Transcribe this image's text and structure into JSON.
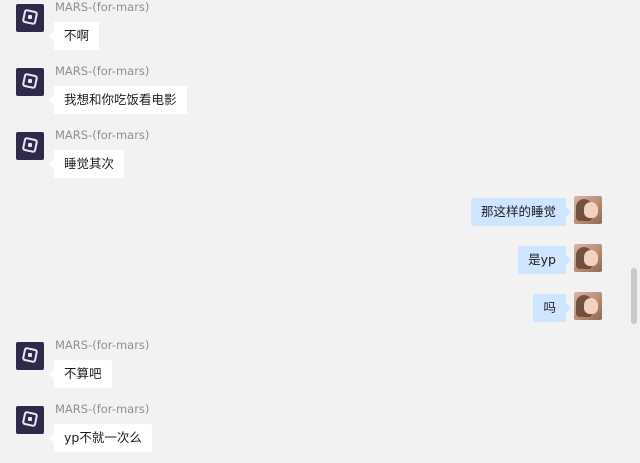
{
  "chat": {
    "messages": [
      {
        "side": "left",
        "sender": "MARS-(for-mars)",
        "text": "不啊"
      },
      {
        "side": "left",
        "sender": "MARS-(for-mars)",
        "text": "我想和你吃饭看电影"
      },
      {
        "side": "left",
        "sender": "MARS-(for-mars)",
        "text": "睡觉其次"
      },
      {
        "side": "right",
        "text": "那这样的睡觉"
      },
      {
        "side": "right",
        "text": "是yp"
      },
      {
        "side": "right",
        "text": "吗"
      },
      {
        "side": "left",
        "sender": "MARS-(for-mars)",
        "text": "不算吧"
      },
      {
        "side": "left",
        "sender": "MARS-(for-mars)",
        "text": "yp不就一次么"
      }
    ]
  }
}
